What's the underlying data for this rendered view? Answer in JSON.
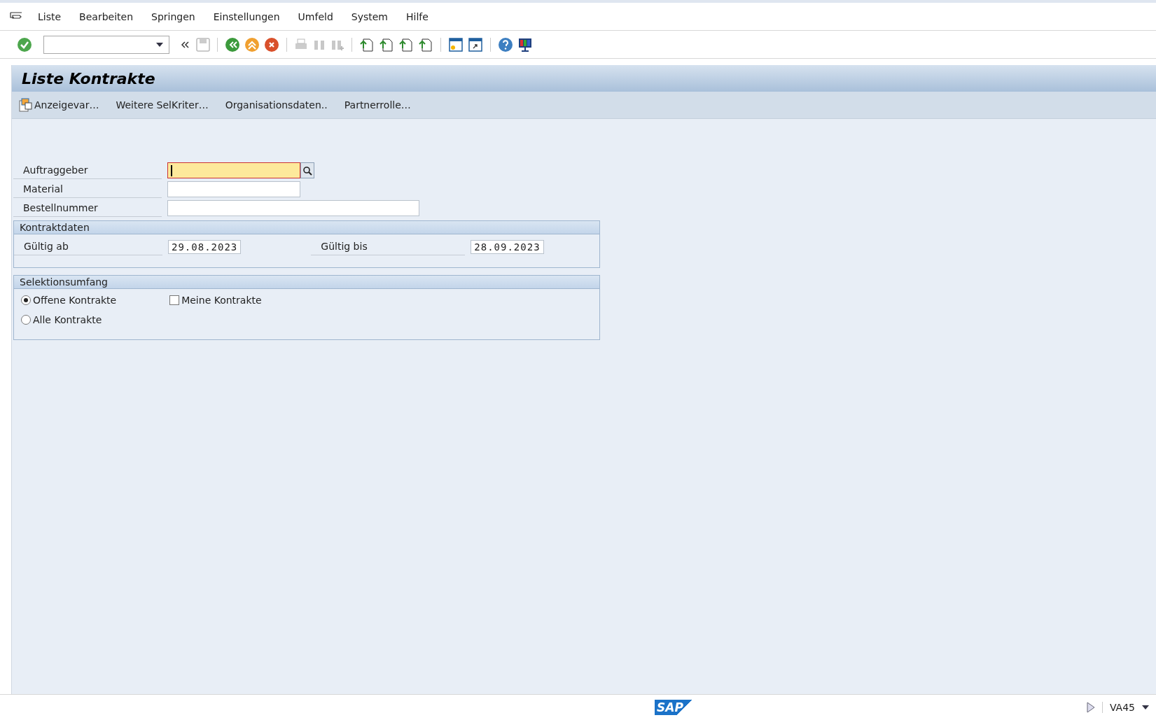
{
  "menu": [
    {
      "label": "Liste"
    },
    {
      "label": "Bearbeiten"
    },
    {
      "label": "Springen"
    },
    {
      "label": "Einstellungen"
    },
    {
      "label": "Umfeld"
    },
    {
      "label": "System"
    },
    {
      "label": "Hilfe"
    }
  ],
  "title": "Liste Kontrakte",
  "app_toolbar": [
    {
      "label": "Anzeigevar…",
      "kind": "icon"
    },
    {
      "label": "Weitere SelKriter…",
      "kind": "text"
    },
    {
      "label": "Organisationsdaten..",
      "kind": "text"
    },
    {
      "label": "Partnerrolle…",
      "kind": "text"
    }
  ],
  "fields": [
    {
      "label": "Auftraggeber",
      "focused": true,
      "search_help": true
    },
    {
      "label": "Material",
      "focused": false,
      "search_help": false
    },
    {
      "label": "Bestellnummer",
      "focused": false,
      "search_help": false
    }
  ],
  "contract_dates": {
    "title": "Kontraktdaten",
    "from": {
      "label": "Gültig ab",
      "value": "29.08.2023"
    },
    "to": {
      "label": "Gültig bis",
      "value": "28.09.2023"
    }
  },
  "selection": {
    "title": "Selektionsumfang",
    "radios": [
      {
        "label": "Offene Kontrakte",
        "selected": true
      },
      {
        "label": "Alle Kontrakte",
        "selected": false
      }
    ],
    "checkbox": {
      "label": "Meine Kontrakte",
      "checked": false
    }
  },
  "status_bar": {
    "logo": "SAP",
    "transaction": "VA45"
  }
}
